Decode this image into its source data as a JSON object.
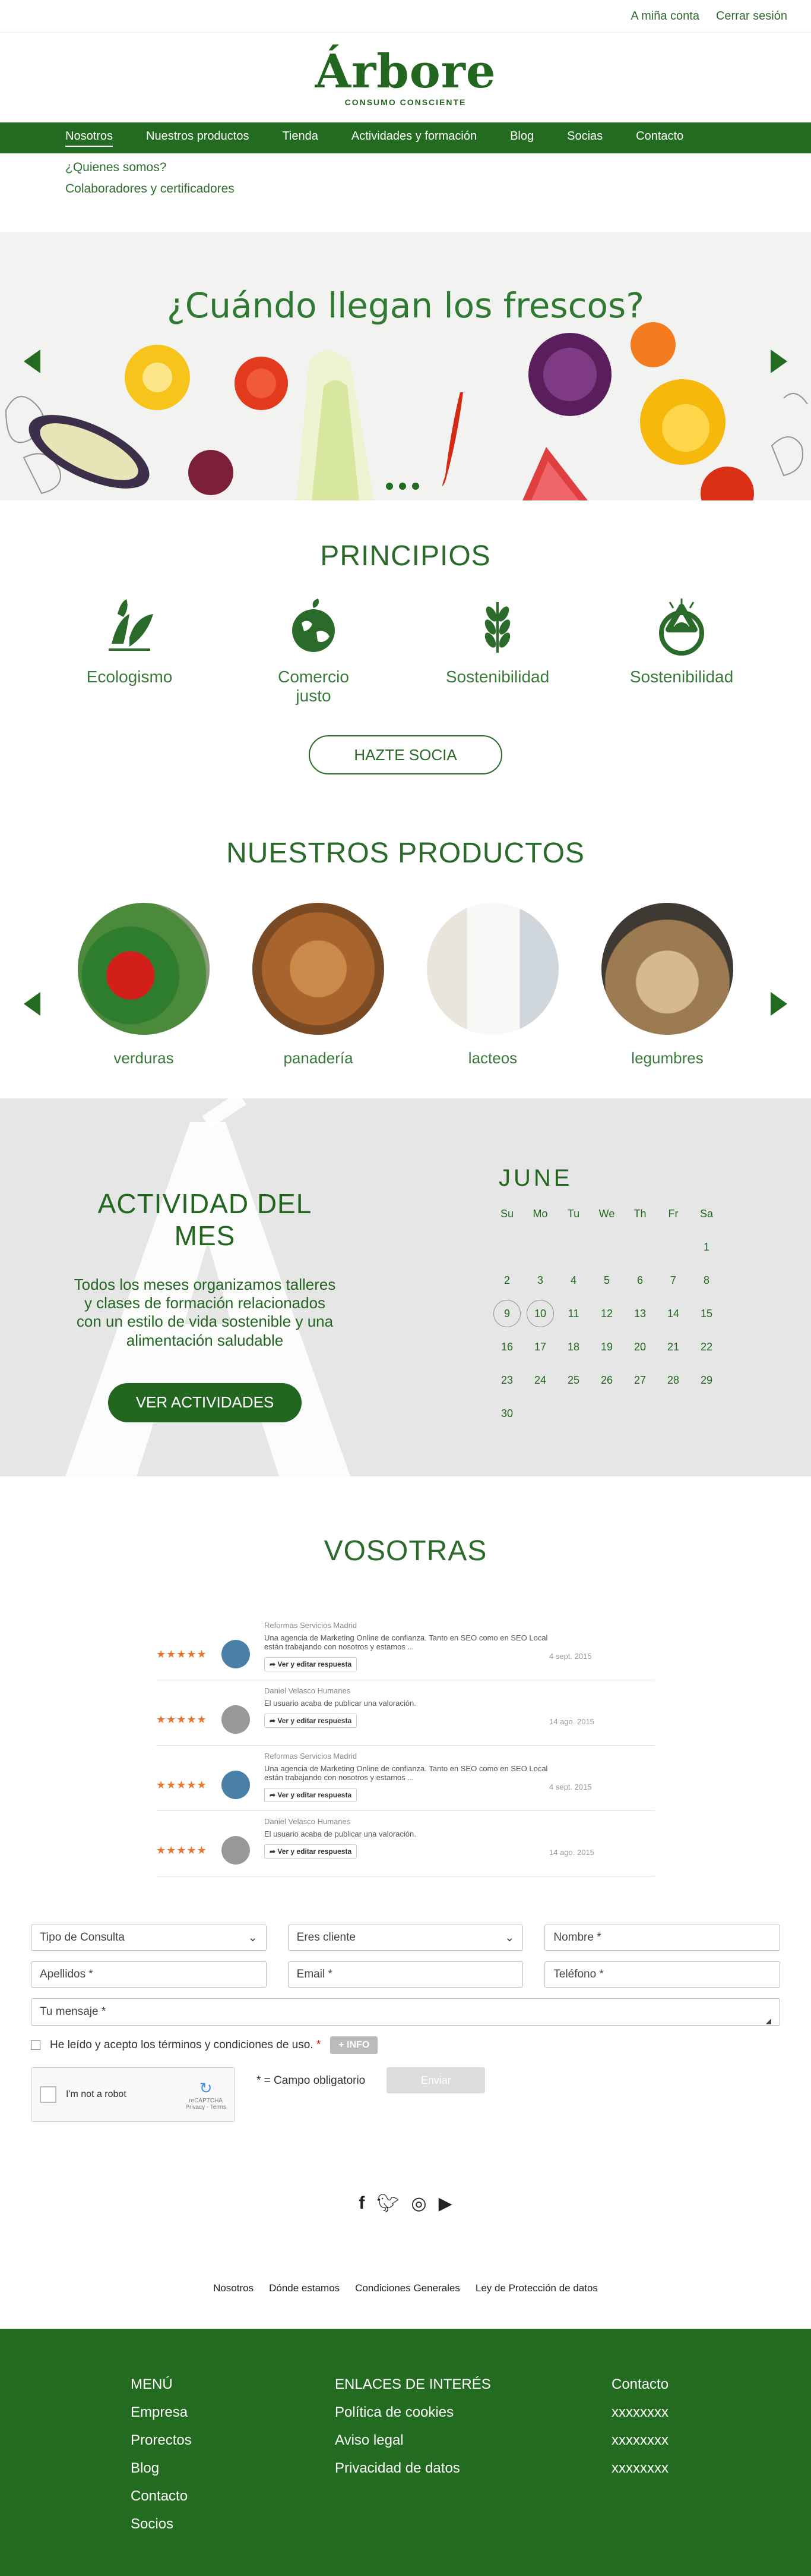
{
  "topbar": {
    "account": "A miña conta",
    "logout": "Cerrar sesión"
  },
  "logo": {
    "title": "Árbore",
    "subtitle": "CONSUMO CONSCIENTE"
  },
  "nav": [
    "Nosotros",
    "Nuestros productos",
    "Tienda",
    "Actividades y formación",
    "Blog",
    "Socias",
    "Contacto"
  ],
  "subnav": [
    "¿Quienes somos?",
    "Colaboradores y certificadores"
  ],
  "hero": {
    "title": "¿Cuándo llegan los frescos?"
  },
  "principios": {
    "title": "PRINCIPIOS",
    "items": [
      "Ecologismo",
      "Comercio justo",
      "Sostenibilidad",
      "Sostenibilidad"
    ],
    "button": "HAZTE SOCIA"
  },
  "productos": {
    "title": "NUESTROS PRODUCTOS",
    "items": [
      "verduras",
      "panadería",
      "lacteos",
      "legumbres"
    ]
  },
  "actividad": {
    "title": "ACTIVIDAD DEL MES",
    "text": "Todos los meses organizamos talleres y clases de formación relacionados con un estilo de vida sostenible y una alimentación saludable",
    "button": "VER ACTIVIDADES"
  },
  "calendar": {
    "month": "JUNE",
    "weekdays": [
      "Su",
      "Mo",
      "Tu",
      "We",
      "Th",
      "Fr",
      "Sa"
    ],
    "weeks": [
      [
        "",
        "",
        "",
        "",
        "",
        "",
        "1"
      ],
      [
        "2",
        "3",
        "4",
        "5",
        "6",
        "7",
        "8"
      ],
      [
        "9",
        "10",
        "11",
        "12",
        "13",
        "14",
        "15"
      ],
      [
        "16",
        "17",
        "18",
        "19",
        "20",
        "21",
        "22"
      ],
      [
        "23",
        "24",
        "25",
        "26",
        "27",
        "28",
        "29"
      ],
      [
        "30",
        "",
        "",
        "",
        "",
        "",
        ""
      ]
    ],
    "highlighted": [
      "9",
      "10"
    ]
  },
  "vosotras": {
    "title": "VOSOTRAS",
    "reviews": [
      {
        "stars": "★★★★★",
        "name": "Reformas Servicios Madrid",
        "text": "Una agencia de Marketing Online de confianza. Tanto en SEO como en SEO Local están trabajando con nosotros y estamos ...",
        "button": "Ver y editar respuesta",
        "date": "4 sept. 2015"
      },
      {
        "stars": "★★★★★",
        "name": "Daniel Velasco Humanes",
        "text": "El usuario acaba de publicar una valoración.",
        "button": "Ver y editar respuesta",
        "date": "14 ago. 2015"
      },
      {
        "stars": "★★★★★",
        "name": "Reformas Servicios Madrid",
        "text": "Una agencia de Marketing Online de confianza. Tanto en SEO como en SEO Local están trabajando con nosotros y estamos ...",
        "button": "Ver y editar respuesta",
        "date": "4 sept. 2015"
      },
      {
        "stars": "★★★★★",
        "name": "Daniel Velasco Humanes",
        "text": "El usuario acaba de publicar una valoración.",
        "button": "Ver y editar respuesta",
        "date": "14 ago. 2015"
      }
    ]
  },
  "form": {
    "tipo": "Tipo de Consulta",
    "cliente": "Eres cliente",
    "nombre": "Nombre *",
    "apellidos": "Apellidos *",
    "email": "Email *",
    "telefono": "Teléfono *",
    "mensaje": "Tu mensaje *",
    "check": "He leído y acepto los términos y condiciones de uso.",
    "check_star": "*",
    "info": "+ INFO",
    "recaptcha": "I'm not a robot",
    "recaptcha_brand": "reCAPTCHA",
    "recaptcha_terms": "Privacy - Terms",
    "required": "* = Campo obligatorio",
    "send": "Enviar"
  },
  "footlinks": [
    "Nosotros",
    "Dónde estamos",
    "Condiciones Generales",
    "Ley de Protección de datos"
  ],
  "footer": {
    "col1_title": "MENÚ",
    "col1": [
      "Empresa",
      "Prorectos",
      "Blog",
      "Contacto",
      "Socios"
    ],
    "col2_title": "ENLACES DE INTERÉS",
    "col2": [
      "Política de cookies",
      "Aviso legal",
      "Privacidad de datos"
    ],
    "col3_title": "Contacto",
    "col3": [
      "xxxxxxxx",
      "xxxxxxxx",
      "xxxxxxxx"
    ]
  },
  "colors": {
    "brand_green": "#236b20",
    "star_orange": "#e8762c",
    "grey_band": "#e6e6e6"
  },
  "icons": [
    "leaf-hand-icon",
    "globe-icon",
    "wheat-icon",
    "recycle-icon",
    "facebook-icon",
    "twitter-icon",
    "instagram-icon",
    "youtube-icon",
    "reply-arrow-icon"
  ]
}
